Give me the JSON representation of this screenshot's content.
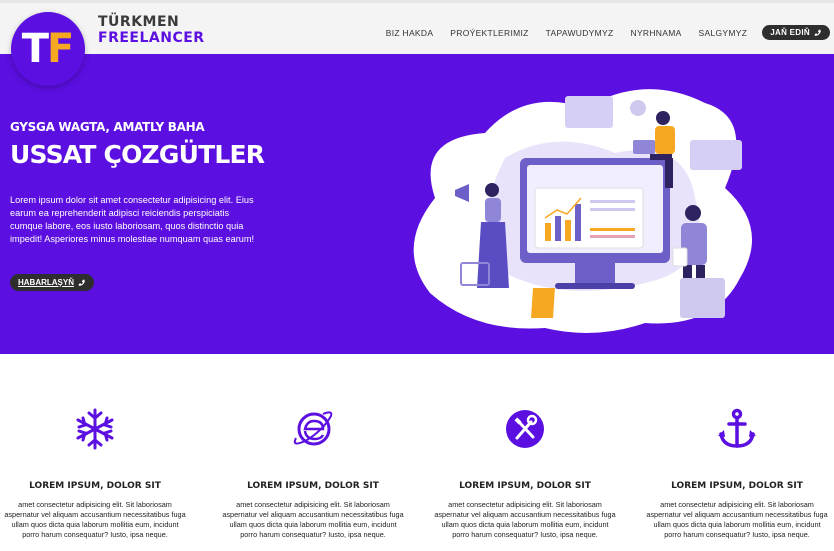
{
  "brand": {
    "logo_t": "T",
    "logo_f": "F",
    "name_line1": "TÜRKMEN",
    "name_line2": "FREELANCER",
    "accent_color": "#5b0fe0",
    "logo_f_color": "#f7a823"
  },
  "nav": {
    "items": [
      {
        "label": "BIZ HAKDA"
      },
      {
        "label": "PROÝEKTLERIMIZ"
      },
      {
        "label": "TAPAWUDYMYZ"
      },
      {
        "label": "NYRHNAMA"
      },
      {
        "label": "SALGYMYZ"
      }
    ],
    "cta_label": "JAŇ EDIŇ",
    "cta_icon": "phone-icon"
  },
  "hero": {
    "subtitle": "GYSGA WAGTA, AMATLY BAHA",
    "title": "USSAT ÇOZGÜTLER",
    "text": "Lorem ipsum dolor sit amet consectetur adipisicing elit. Eius earum ea reprehenderit adipisci reiciendis perspiciatis cumque labore, eos iusto laboriosam, quos distinctio quia impedit! Asperiores minus molestiae numquam quas earum!",
    "button_label": "HABARLAŞYŇ",
    "button_icon": "phone-icon",
    "illustration": "team-working-on-dashboard-illustration"
  },
  "features": [
    {
      "icon": "snowflake-icon",
      "title": "LOREM IPSUM, DOLOR SIT",
      "text": "amet consectetur adipisicing elit. Sit laboriosam aspernatur vel aliquam accusantium necessitatibus fuga ullam quos dicta quia laborum mollitia eum, incidunt porro harum consequatur? Iusto, ipsa neque."
    },
    {
      "icon": "internet-explorer-icon",
      "title": "LOREM IPSUM, DOLOR SIT",
      "text": "amet consectetur adipisicing elit. Sit laboriosam aspernatur vel aliquam accusantium necessitatibus fuga ullam quos dicta quia laborum mollitia eum, incidunt porro harum consequatur? Iusto, ipsa neque."
    },
    {
      "icon": "tools-icon",
      "title": "LOREM IPSUM, DOLOR SIT",
      "text": "amet consectetur adipisicing elit. Sit laboriosam aspernatur vel aliquam accusantium necessitatibus fuga ullam quos dicta quia laborum mollitia eum, incidunt porro harum consequatur? Iusto, ipsa neque."
    },
    {
      "icon": "anchor-icon",
      "title": "LOREM IPSUM, DOLOR SIT",
      "text": "amet consectetur adipisicing elit. Sit laboriosam aspernatur vel aliquam accusantium necessitatibus fuga ullam quos dicta quia laborum mollitia eum, incidunt porro harum consequatur? Iusto, ipsa neque."
    }
  ]
}
